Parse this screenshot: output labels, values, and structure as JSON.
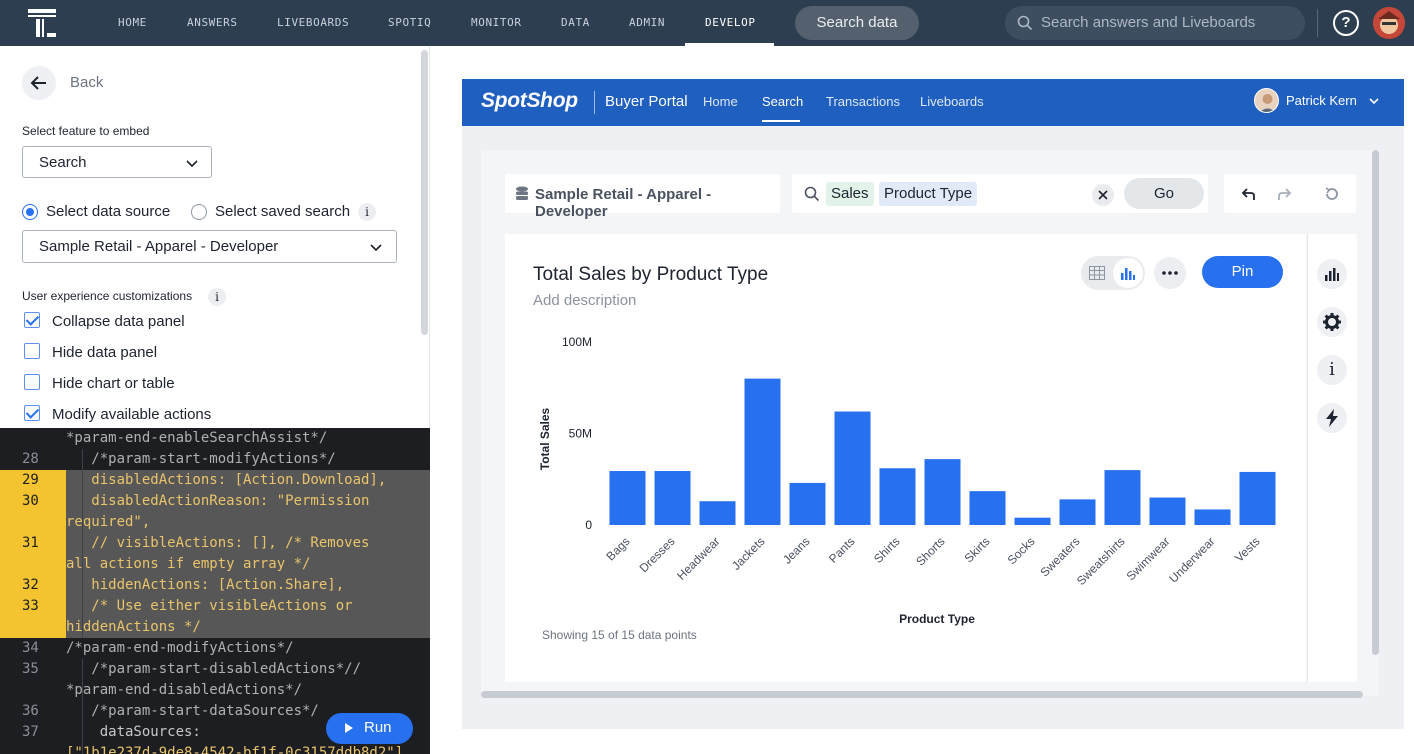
{
  "topnav": {
    "items": [
      "HOME",
      "ANSWERS",
      "LIVEBOARDS",
      "SPOTIQ",
      "MONITOR",
      "DATA",
      "ADMIN",
      "DEVELOP"
    ],
    "active": "DEVELOP",
    "search_data": "Search data",
    "search_answers_placeholder": "Search answers and Liveboards",
    "help": "?"
  },
  "left": {
    "back": "Back",
    "feature_label": "Select feature to embed",
    "feature_value": "Search",
    "radio_data_source": "Select data source",
    "radio_saved_search": "Select saved search",
    "info": "i",
    "data_source_value": "Sample Retail - Apparel - Developer",
    "ux_label": "User experience customizations",
    "checks": [
      {
        "label": "Collapse data panel",
        "checked": true
      },
      {
        "label": "Hide data panel",
        "checked": false
      },
      {
        "label": "Hide chart or table",
        "checked": false
      },
      {
        "label": "Modify available actions",
        "checked": true
      }
    ]
  },
  "code": {
    "lines": [
      {
        "num": "",
        "text": "*param-end-enableSearchAssist*/",
        "hl": false,
        "cls": "cm"
      },
      {
        "num": "28",
        "text": "   /*param-start-modifyActions*/",
        "hl": false,
        "cls": "cm"
      },
      {
        "num": "29",
        "text": "   disabledActions: [Action.Download],",
        "hl": true,
        "cls": "kw"
      },
      {
        "num": "30",
        "text": "   disabledActionReason: \"Permission",
        "hl": true,
        "cls": "kw"
      },
      {
        "num": "",
        "text": "required\",",
        "hl": true,
        "cls": "kw"
      },
      {
        "num": "31",
        "text": "   // visibleActions: [], /* Removes",
        "hl": true,
        "cls": "kw"
      },
      {
        "num": "",
        "text": "all actions if empty array */",
        "hl": true,
        "cls": "kw"
      },
      {
        "num": "32",
        "text": "   hiddenActions: [Action.Share],",
        "hl": true,
        "cls": "kw"
      },
      {
        "num": "33",
        "text": "   /* Use either visibleActions or",
        "hl": true,
        "cls": "kw"
      },
      {
        "num": "",
        "text": "hiddenActions */",
        "hl": true,
        "cls": "kw"
      },
      {
        "num": "34",
        "text": "/*param-end-modifyActions*/",
        "hl": false,
        "cls": "cm"
      },
      {
        "num": "35",
        "text": "   /*param-start-disabledActions*//",
        "hl": false,
        "cls": "cm"
      },
      {
        "num": "",
        "text": "*param-end-disabledActions*/",
        "hl": false,
        "cls": "cm"
      },
      {
        "num": "36",
        "text": "   /*param-start-dataSources*/",
        "hl": false,
        "cls": "cm"
      },
      {
        "num": "37",
        "text": "    dataSources:",
        "hl": false,
        "cls": "plain"
      },
      {
        "num": "",
        "text": "[\"1b1e237d-9de8-4542-bf1f-0c3157ddb8d2\"]",
        "hl": false,
        "cls": "kw"
      }
    ],
    "run": "Run"
  },
  "shop": {
    "logo": "SpotShop",
    "portal": "Buyer Portal",
    "nav": [
      "Home",
      "Search",
      "Transactions",
      "Liveboards"
    ],
    "active": "Search",
    "user": "Patrick Kern"
  },
  "search": {
    "datasource": "Sample Retail - Apparel - Developer",
    "tokens": [
      "Sales",
      "Product Type"
    ],
    "go": "Go"
  },
  "chart": {
    "title": "Total Sales by Product Type",
    "description": "Add description",
    "pin": "Pin",
    "footnote": "Showing 15 of 15 data points"
  },
  "chart_data": {
    "type": "bar",
    "categories": [
      "Bags",
      "Dresses",
      "Headwear",
      "Jackets",
      "Jeans",
      "Pants",
      "Shirts",
      "Shorts",
      "Skirts",
      "Socks",
      "Sweaters",
      "Sweatshirts",
      "Swimwear",
      "Underwear",
      "Vests"
    ],
    "values": [
      29.5,
      29.5,
      13,
      80,
      23,
      62,
      31,
      36,
      18.5,
      4,
      14,
      30,
      15,
      8.5,
      29
    ],
    "title": "Total Sales by Product Type",
    "xlabel": "Product Type",
    "ylabel": "Total Sales",
    "yticks": [
      "0",
      "50M",
      "100M"
    ],
    "ylim": [
      0,
      100
    ],
    "color": "#2770ef",
    "grid": false
  }
}
